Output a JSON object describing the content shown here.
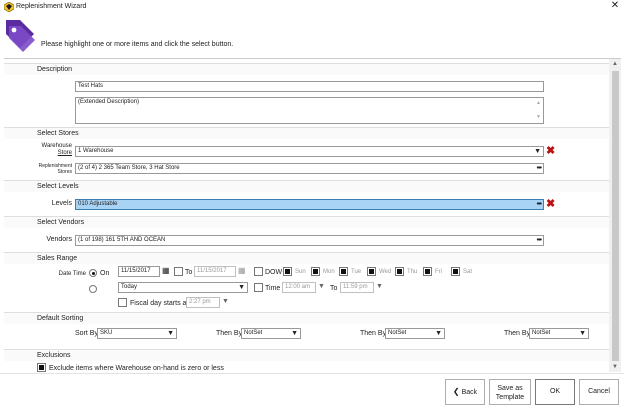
{
  "window": {
    "title": "Replenishment Wizard",
    "close_glyph": "✕",
    "icon": "app-gem-icon"
  },
  "header": {
    "instruction": "Please highlight one or more items and click the select button.",
    "icon": "tag-icon",
    "icon_color": "#5b2ca0"
  },
  "description": {
    "section": "Description",
    "name_value": "Test Hats",
    "ext_value": "(Extended Description)"
  },
  "stores": {
    "section": "Select Stores",
    "warehouse_label_1": "Warehouse",
    "warehouse_label_2": "Store",
    "warehouse_value": "1 Warehouse",
    "repl_label_1": "Replenishment",
    "repl_label_2": "Stores",
    "repl_value": "(2 of 4) 2 365 Team Store, 3 Hat Store"
  },
  "levels": {
    "section": "Select Levels",
    "label": "Levels",
    "value": "010 Adjustable"
  },
  "vendors": {
    "section": "Select Vendors",
    "label": "Vendors",
    "value": "(1 of 198) 161 5TH AND OCEAN"
  },
  "sales": {
    "section": "Sales Range",
    "date_time_label": "Date Time",
    "on_label": "On",
    "from_date": "11/15/2017",
    "to_label": "To",
    "to_date": "11/15/2017",
    "dow_label": "DOW",
    "days": [
      "Sun",
      "Mon",
      "Tue",
      "Wed",
      "Thu",
      "Fri",
      "Sat"
    ],
    "period_value": "Today",
    "time_label": "Time",
    "time_from": "12:00 am",
    "time_to_label": "To",
    "time_to": "11:59 pm",
    "fiscal_label": "Fiscal day starts at",
    "fiscal_time": "2:27 pm"
  },
  "sorting": {
    "section": "Default Sorting",
    "sort_by_label": "Sort By",
    "sort_by_value": "SKU",
    "then_by_label": "Then By",
    "then_values": [
      "NotSet",
      "NotSet",
      "NotSet"
    ]
  },
  "exclusions": {
    "section": "Exclusions",
    "exclude_label": "Exclude items where Warehouse on-hand is zero or less",
    "checked": true
  },
  "footer": {
    "back": "Back",
    "save_template_1": "Save as",
    "save_template_2": "Template",
    "ok": "OK",
    "cancel": "Cancel"
  }
}
